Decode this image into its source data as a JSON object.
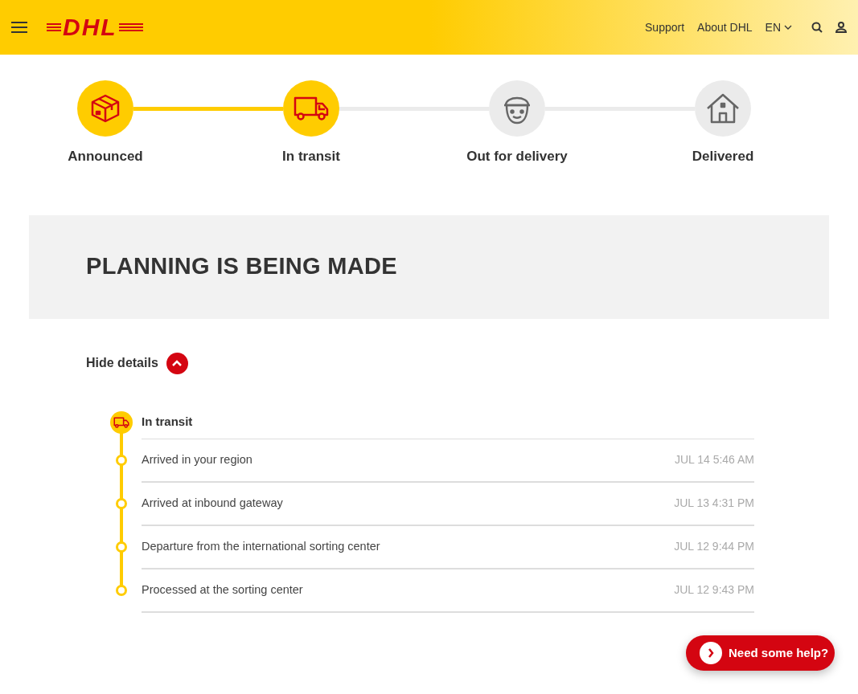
{
  "header": {
    "logo": "DHL",
    "links": [
      "Support",
      "About DHL"
    ],
    "language": "EN"
  },
  "steps": [
    {
      "label": "Announced",
      "kind": "box",
      "done": true
    },
    {
      "label": "In transit",
      "kind": "truck",
      "done": true
    },
    {
      "label": "Out for delivery",
      "kind": "courier",
      "done": false
    },
    {
      "label": "Delivered",
      "kind": "house",
      "done": false
    }
  ],
  "status": {
    "title": "PLANNING IS BEING MADE"
  },
  "details": {
    "toggle": "Hide details",
    "expanded": true
  },
  "timeline": {
    "current": "In transit",
    "events": [
      {
        "text": "Arrived in your region",
        "time": "JUL 14 5:46 AM"
      },
      {
        "text": "Arrived at inbound gateway",
        "time": "JUL 13 4:31 PM"
      },
      {
        "text": "Departure from the international sorting center",
        "time": "JUL 12 9:44 PM"
      },
      {
        "text": "Processed at the sorting center",
        "time": "JUL 12 9:43 PM"
      }
    ]
  },
  "help": {
    "label": "Need some help?"
  }
}
